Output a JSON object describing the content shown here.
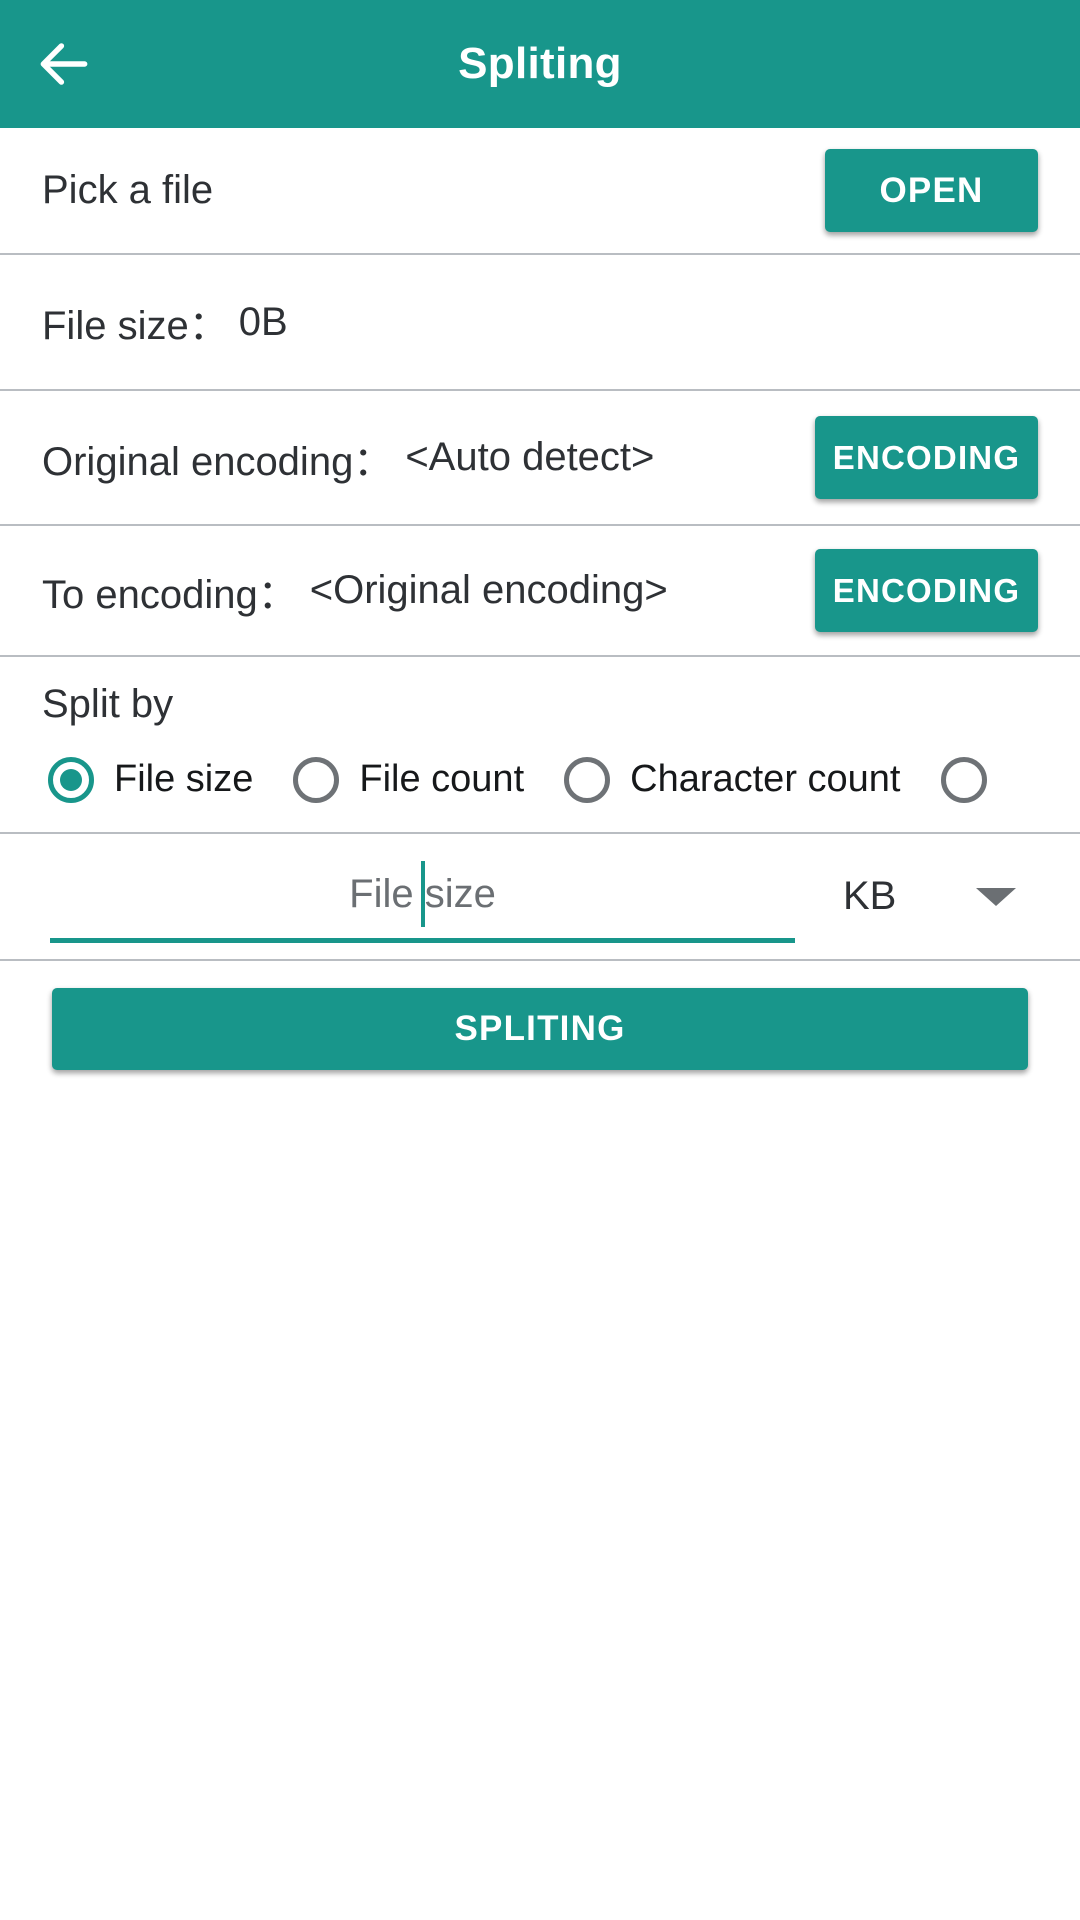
{
  "theme": {
    "accent": "#18968B",
    "text_primary": "#2e3135",
    "divider": "#b9bdc2",
    "radio_unselected": "#6e7276",
    "placeholder": "#6b6f73"
  },
  "appbar": {
    "title": "Spliting",
    "back_icon": "arrow-left-icon"
  },
  "rows": {
    "pick_file": {
      "label": "Pick a file",
      "button": "OPEN"
    },
    "file_size": {
      "label": "File size：",
      "value": "0B"
    },
    "original_encoding": {
      "label": "Original encoding：",
      "value": "<Auto detect>",
      "button": "ENCODING"
    },
    "to_encoding": {
      "label": "To encoding：",
      "value": "<Original encoding>",
      "button": "ENCODING"
    }
  },
  "split_by": {
    "title": "Split by",
    "options": [
      {
        "label": "File size",
        "selected": true
      },
      {
        "label": "File count",
        "selected": false
      },
      {
        "label": "Character count",
        "selected": false
      },
      {
        "label": "",
        "selected": false
      }
    ]
  },
  "amount_input": {
    "placeholder": "File size",
    "value": "",
    "caret_visible": true
  },
  "unit_select": {
    "selected": "KB",
    "icon": "chevron-down-icon"
  },
  "action": {
    "label": "SPLITING"
  }
}
